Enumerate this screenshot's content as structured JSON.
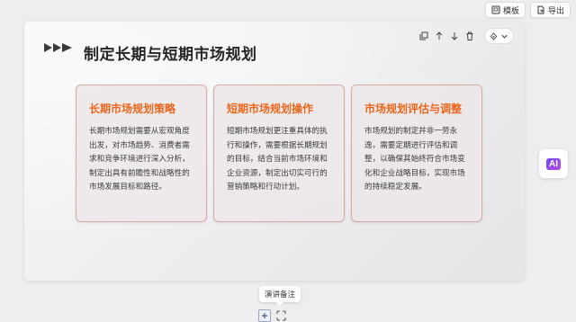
{
  "toolbar": {
    "template_label": "模板",
    "export_label": "导出"
  },
  "slide": {
    "title": "制定长期与短期市场规划",
    "cards": [
      {
        "title": "长期市场规划策略",
        "body": "长期市场规划需要从宏观角度出发，对市场趋势、消费者需求和竞争环境进行深入分析，制定出具有前瞻性和战略性的市场发展目标和路径。"
      },
      {
        "title": "短期市场规划操作",
        "body": "短期市场规划更注重具体的执行和操作，需要根据长期规划的目标，结合当前市场环境和企业资源，制定出切实可行的营销策略和行动计划。"
      },
      {
        "title": "市场规划评估与调整",
        "body": "市场规划的制定并非一劳永逸，需要定期进行评估和调整，以确保其始终符合市场变化和企业战略目标，实现市场的持续稳定发展。"
      }
    ]
  },
  "ai_button": {
    "label": "AI"
  },
  "notes": {
    "tooltip": "演讲备注"
  },
  "colors": {
    "accent": "#e9671d",
    "card_border": "#d6a9a3",
    "ai_gradient_start": "#6e4cf5",
    "ai_gradient_end": "#b548e8"
  },
  "icons": [
    "template-icon",
    "export-icon",
    "copy-icon",
    "move-up-icon",
    "move-down-icon",
    "delete-icon",
    "style-icon",
    "chevron-down-icon",
    "plus-icon",
    "expand-icon"
  ]
}
